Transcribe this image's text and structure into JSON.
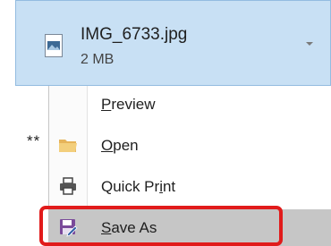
{
  "attachment": {
    "file_name": "IMG_6733.jpg",
    "file_size": "2 MB",
    "icon": "image-file-icon"
  },
  "background_text": "**",
  "menu": {
    "items": [
      {
        "id": "preview",
        "accel": "P",
        "rest": "review",
        "icon": null
      },
      {
        "id": "open",
        "accel": "O",
        "rest": "pen",
        "icon": "folder-icon"
      },
      {
        "id": "quick-print",
        "before": "Quick Pr",
        "accel": "i",
        "after": "nt",
        "icon": "printer-icon"
      },
      {
        "id": "save-as",
        "accel": "S",
        "rest": "ave As",
        "icon": "save-as-icon",
        "highlighted": true
      }
    ]
  },
  "colors": {
    "attachment_bg": "#c8e0f4",
    "highlight_bg": "#c6c6c6",
    "annotation_red": "#e11b1b"
  }
}
